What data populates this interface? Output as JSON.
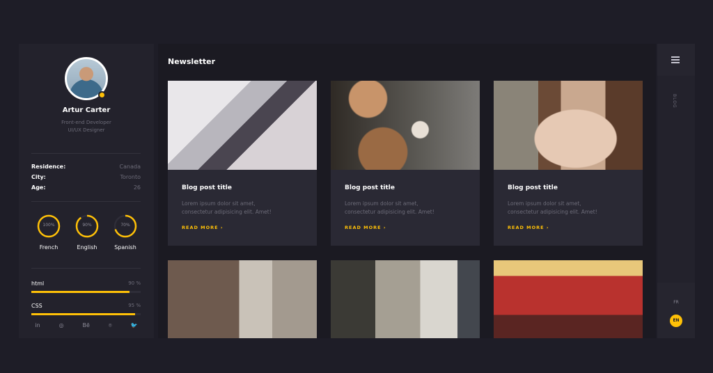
{
  "profile": {
    "name": "Artur Carter",
    "role_line1": "Front-end Developer",
    "role_line2": "UI/UX Designer"
  },
  "info": [
    {
      "key": "Residence:",
      "value": "Canada"
    },
    {
      "key": "City:",
      "value": "Toronto"
    },
    {
      "key": "Age:",
      "value": "26"
    }
  ],
  "languages": [
    {
      "name": "French",
      "percent": 100,
      "label": "100%"
    },
    {
      "name": "English",
      "percent": 90,
      "label": "90%"
    },
    {
      "name": "Spanish",
      "percent": 70,
      "label": "70%"
    }
  ],
  "skills": [
    {
      "name": "html",
      "percent": 90,
      "label": "90 %"
    },
    {
      "name": "CSS",
      "percent": 95,
      "label": "95 %"
    }
  ],
  "socials": [
    "in",
    "◎",
    "Bē",
    "⌾",
    "🐦"
  ],
  "newsletter": {
    "title": "Newsletter",
    "cards": [
      {
        "title": "Blog post title",
        "body1": "Lorem ipsum dolor sit amet,",
        "body2": "consectetur adipisicing elit. Amet!",
        "more": "READ MORE ›"
      },
      {
        "title": "Blog post title",
        "body1": "Lorem ipsum dolor sit amet,",
        "body2": "consectetur adipisicing elit. Amet!",
        "more": "READ MORE ›"
      },
      {
        "title": "Blog post title",
        "body1": "Lorem ipsum dolor sit amet,",
        "body2": "consectetur adipisicing elit. Amet!",
        "more": "READ MORE ›"
      }
    ]
  },
  "rail": {
    "vertical_label": "BLOG",
    "lang_fr": "FR",
    "lang_en": "EN"
  },
  "colors": {
    "accent": "#ffc107",
    "bg": "#1e1d27",
    "panel": "#23222c"
  }
}
